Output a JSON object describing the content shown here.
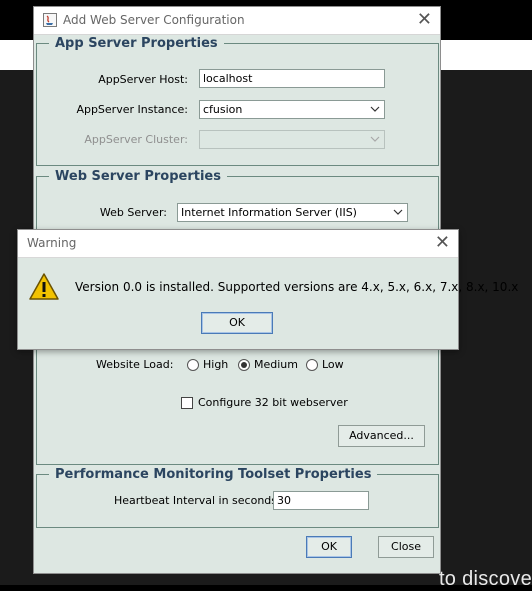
{
  "background": {
    "caption": "to discove"
  },
  "dialog": {
    "title": "Add Web Server Configuration",
    "app_group": {
      "legend": "App Server Properties",
      "host_label": "AppServer Host:",
      "host_value": "localhost",
      "instance_label": "AppServer Instance:",
      "instance_value": "cfusion",
      "cluster_label": "AppServer Cluster:",
      "cluster_value": ""
    },
    "web_group": {
      "legend": "Web Server Properties",
      "server_label": "Web Server:",
      "server_value": "Internet Information Server (IIS)",
      "load_label": "Website Load:",
      "load_options": [
        "High",
        "Medium",
        "Low"
      ],
      "load_selected": "Medium",
      "configure32_label": "Configure 32 bit webserver",
      "configure32_checked": false,
      "advanced_label": "Advanced..."
    },
    "perf_group": {
      "legend": "Performance Monitoring Toolset Properties",
      "heartbeat_label": "Heartbeat Interval in seconds:",
      "heartbeat_value": "30"
    },
    "ok_label": "OK",
    "close_label": "Close"
  },
  "warning": {
    "title": "Warning",
    "message": "Version 0.0 is installed.  Supported versions are 4.x, 5.x, 6.x, 7.x, 8.x, 10.x",
    "ok_label": "OK",
    "icon": "warning-icon"
  },
  "colors": {
    "dialog_bg": "#dde7e2",
    "legend_text": "#2b4560",
    "focus_border": "#4a7ab7",
    "warning_yellow": "#f2c200"
  }
}
